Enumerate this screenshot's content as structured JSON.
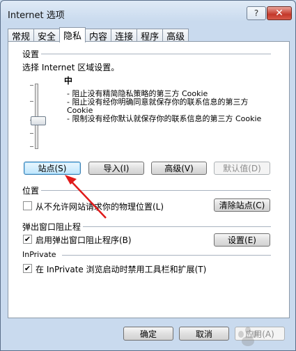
{
  "window": {
    "title": "Internet 选项",
    "help_label": "?",
    "close_label": "✕"
  },
  "tabs": [
    "常规",
    "安全",
    "隐私",
    "内容",
    "连接",
    "程序",
    "高级"
  ],
  "settings": {
    "label": "设置",
    "zone_text": "选择 Internet 区域设置。",
    "level": "中",
    "descriptions": [
      "- 阻止没有精简隐私策略的第三方 Cookie",
      "- 阻止没有经你明确同意就保存你的联系信息的第三方 Cookie",
      "- 限制没有经你默认就保存你的联系信息的第三方 Cookie"
    ],
    "buttons": {
      "sites": "站点(S)",
      "import": "导入(I)",
      "advanced": "高级(V)",
      "default": "默认值(D)"
    }
  },
  "location": {
    "label": "位置",
    "checkbox_label": "从不允许网站请求你的物理位置(L)",
    "checked": false,
    "clear_button": "清除站点(C)"
  },
  "popup": {
    "label": "弹出窗口阻止程",
    "checkbox_label": "启用弹出窗口阻止程序(B)",
    "checked": true,
    "settings_button": "设置(E)"
  },
  "inprivate": {
    "label": "InPrivate",
    "checkbox_label": "在 InPrivate 浏览启动时禁用工具栏和扩展(T)",
    "checked": true
  },
  "footer": {
    "ok": "确定",
    "cancel": "取消",
    "apply": "应用(A)"
  },
  "colors": {
    "window_bg": "#c9daee",
    "arrow": "#e01a1a",
    "focus_border": "#3c7fb1"
  }
}
